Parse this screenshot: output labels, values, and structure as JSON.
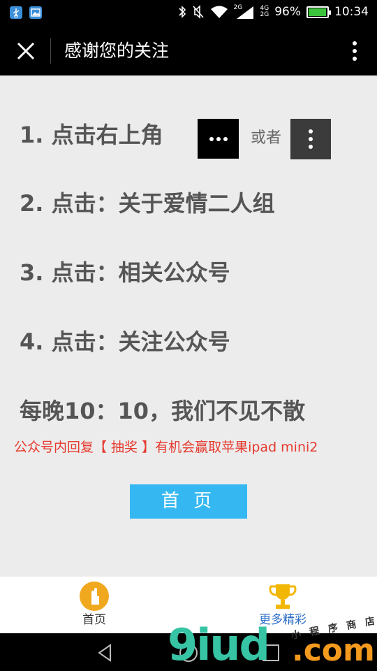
{
  "status_bar": {
    "net_top": "2G",
    "net_a": "4G",
    "net_b": "2G",
    "battery": "96%",
    "battery_level": 0.96,
    "time": "10:34",
    "icons": [
      "usb-icon",
      "image-icon",
      "bluetooth-icon",
      "mute-icon",
      "wifi-icon",
      "signal-icon",
      "battery-icon"
    ]
  },
  "header": {
    "title": "感谢您的关注",
    "close_icon": "close-icon",
    "more_icon": "more-vertical-icon"
  },
  "steps": [
    "1. 点击右上角",
    "2. 点击：关于爱情二人组",
    "3. 点击：相关公众号",
    "4. 点击：关注公众号",
    "每晚10：10，我们不见不散"
  ],
  "or_text": "或者",
  "promo": "公众号内回复【 抽奖 】有机会赢取苹果ipad mini2",
  "home_button": "首 页",
  "tabs": [
    {
      "label": "首页",
      "icon": "home-hand-icon"
    },
    {
      "label": "更多精彩",
      "icon": "trophy-icon"
    }
  ],
  "nav": [
    "back-icon",
    "home-circle-icon",
    "recent-apps-icon"
  ],
  "watermark": {
    "text_a": "9iud",
    "text_b": ".com",
    "small": "小 程 序 商 店"
  },
  "colors": {
    "accent": "#35b8f1",
    "promo": "#e53a2f",
    "tab_active": "#2a6dc8",
    "home_icon": "#f0a81e",
    "trophy": "#f2b705"
  }
}
